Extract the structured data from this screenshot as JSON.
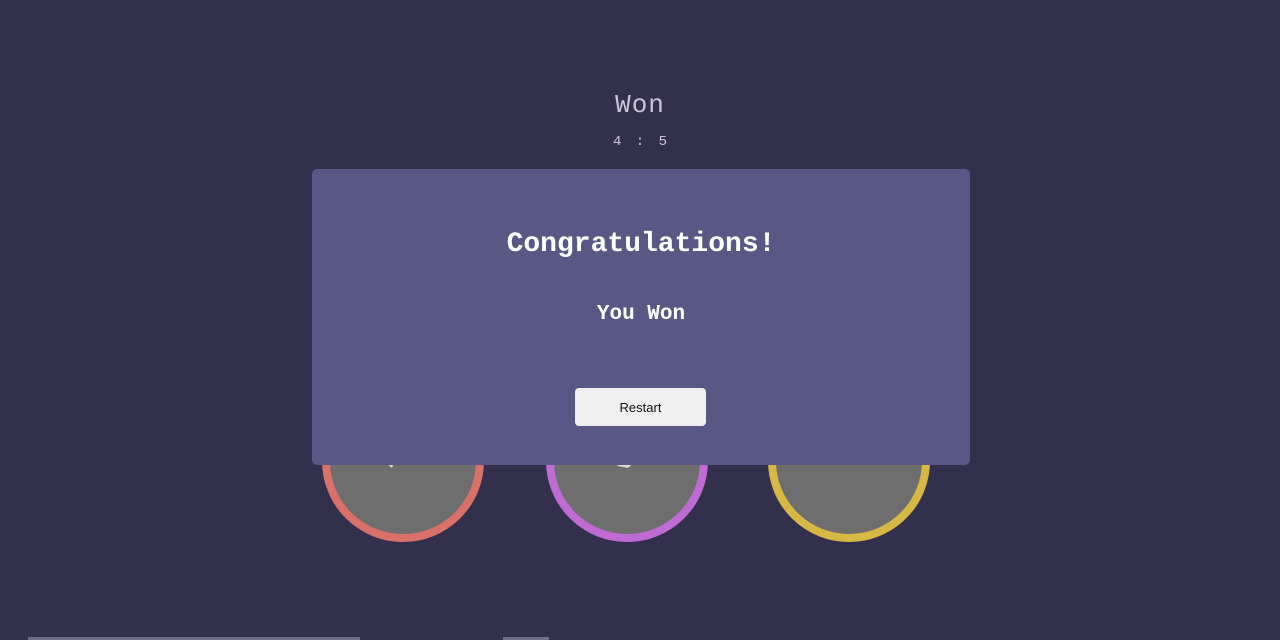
{
  "game": {
    "status_title": "Won",
    "score": "4 : 5"
  },
  "choices": [
    {
      "name": "rock",
      "ring_color": "#d9706a"
    },
    {
      "name": "paper",
      "ring_color": "#c06ad4"
    },
    {
      "name": "scissors",
      "ring_color": "#d8b845"
    }
  ],
  "modal": {
    "heading": "Congratulations!",
    "result": "You Won",
    "restart_label": "Restart"
  },
  "colors": {
    "background": "#33304d",
    "modal_bg": "#595885",
    "text": "#ffffff"
  }
}
